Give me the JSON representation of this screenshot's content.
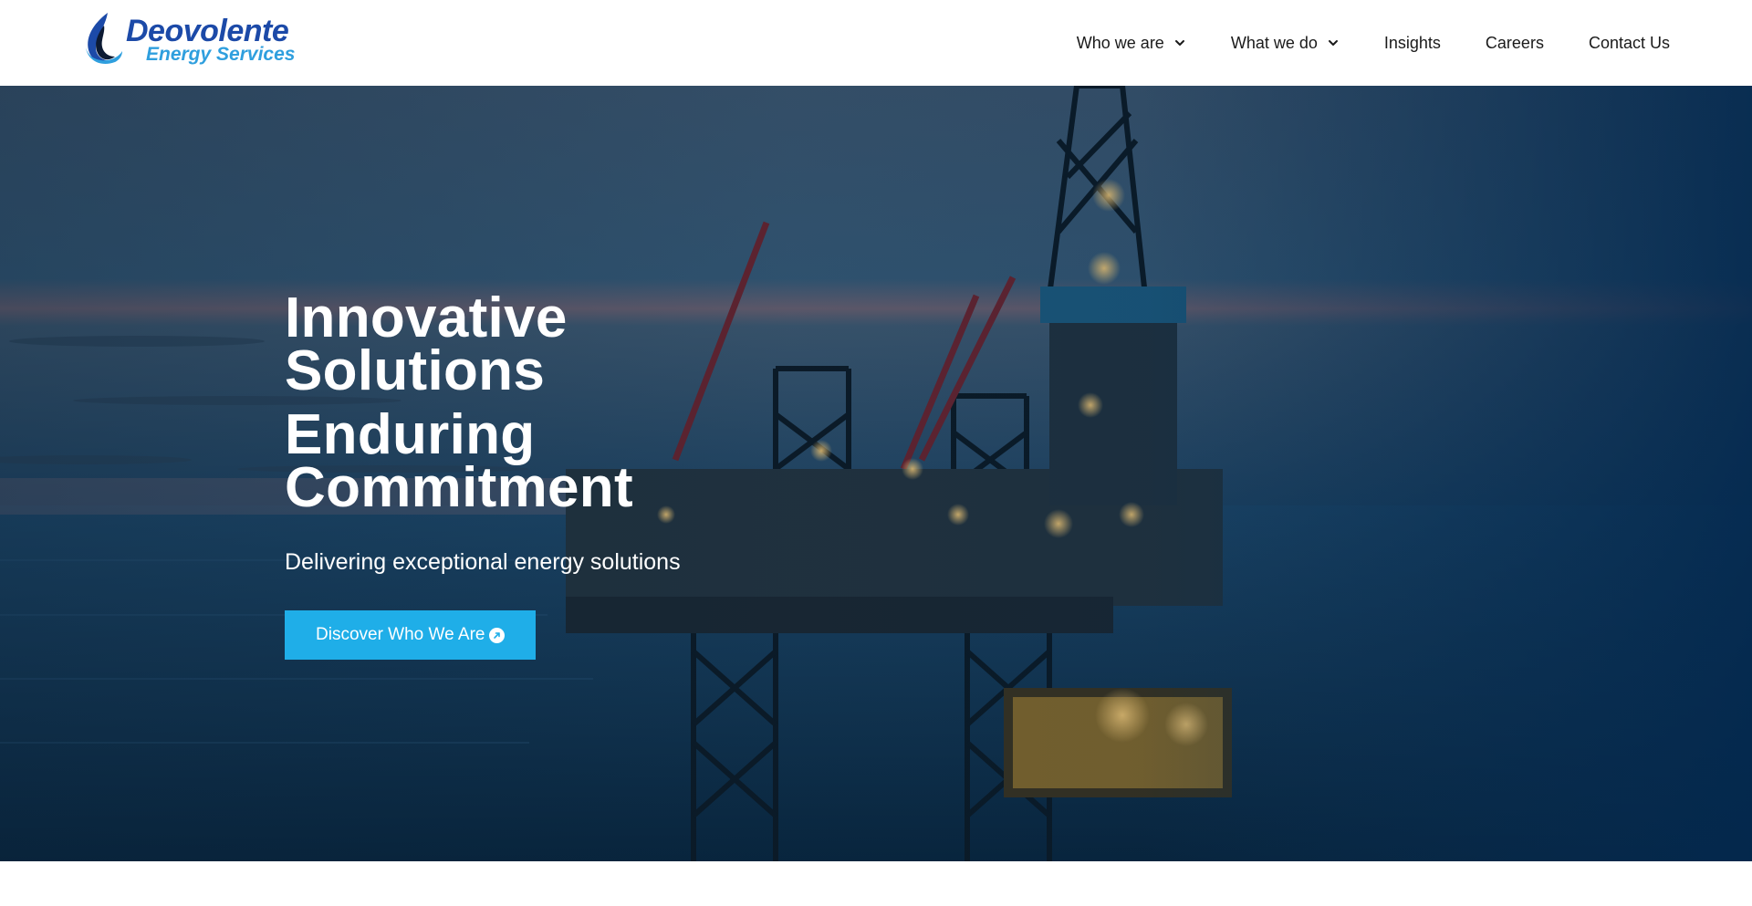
{
  "brand": {
    "name": "Deovolente",
    "tagline": "Energy Services",
    "primary_color": "#1c4aa8",
    "secondary_color": "#2f9fde"
  },
  "nav": {
    "items": [
      {
        "label": "Who we are",
        "has_dropdown": true,
        "icon": "chevron-down-icon"
      },
      {
        "label": "What we do",
        "has_dropdown": true,
        "icon": "chevron-down-icon"
      },
      {
        "label": "Insights",
        "has_dropdown": false
      },
      {
        "label": "Careers",
        "has_dropdown": false
      },
      {
        "label": "Contact Us",
        "has_dropdown": false
      }
    ]
  },
  "hero": {
    "title_line1": "Innovative",
    "title_line2": "Solutions",
    "title_line3": "Enduring",
    "title_line4": "Commitment",
    "subtitle": "Delivering exceptional energy solutions",
    "cta_label": "Discover Who We Are",
    "cta_icon": "arrow-up-right-circle-icon",
    "cta_color": "#1faee8",
    "background": "offshore-oil-rig-photo"
  }
}
